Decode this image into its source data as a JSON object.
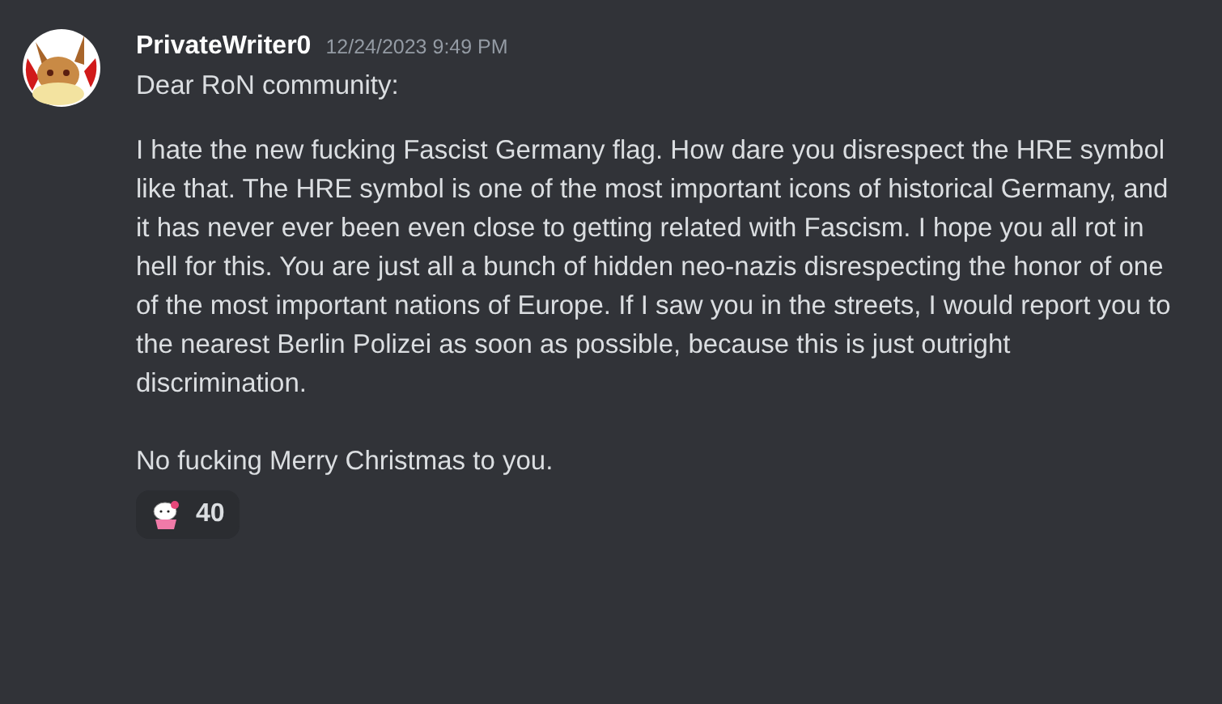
{
  "message": {
    "author": "PrivateWriter0",
    "timestamp": "12/24/2023 9:49 PM",
    "paragraphs": [
      "Dear RoN community:",
      "I hate the new fucking Fascist Germany flag. How dare you disrespect the HRE symbol like that. The HRE symbol is one of the most important icons of historical Germany, and it has never ever been even close to getting related with Fascism. I hope you all rot in hell for this. You are just all a bunch of hidden neo-nazis disrespecting the honor of one of the most important nations of Europe. If I saw you in the streets, I would report you to the nearest Berlin Polizei as soon as possible, because this is just outright discrimination.",
      "No fucking Merry Christmas to you."
    ],
    "reactions": [
      {
        "count": "40",
        "selected": false
      }
    ]
  }
}
